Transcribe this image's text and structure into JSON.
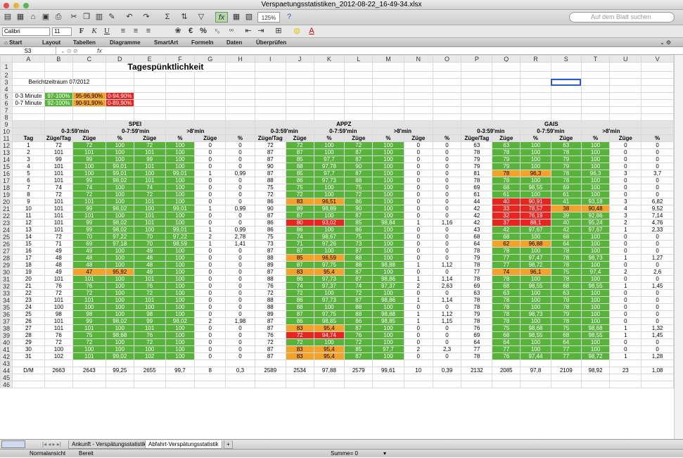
{
  "window": {
    "title": "Verspaetungsstatistiken_2012-08-22_16-49-34.xlsx"
  },
  "toolbar": {
    "zoom": "125%",
    "search_placeholder": "Auf dem Blatt suchen"
  },
  "format": {
    "font": "Calibri",
    "size": "11"
  },
  "ribbon": {
    "tabs": [
      "Start",
      "Layout",
      "Tabellen",
      "Diagramme",
      "SmartArt",
      "Formeln",
      "Daten",
      "Überprüfen"
    ]
  },
  "formula": {
    "cell": "S3",
    "fx": "fx"
  },
  "columns": [
    "A",
    "B",
    "C",
    "D",
    "E",
    "F",
    "G",
    "H",
    "I",
    "J",
    "K",
    "L",
    "M",
    "N",
    "O",
    "P",
    "Q",
    "R",
    "S",
    "T",
    "U",
    "V"
  ],
  "sheet": {
    "title": "Tagespünktlichkeit",
    "period": "Berichtzeitraum 07/2012",
    "legend": [
      {
        "label": "0-3 Minute",
        "g": "97-100%",
        "o": "95-96,90%",
        "r": "0-94,90%"
      },
      {
        "label": "0-7 Minute",
        "g": "92-100%",
        "o": "90-91,90%",
        "r": "0-89,90%"
      }
    ],
    "groups": [
      "SPEI",
      "APPZ",
      "GAIS"
    ],
    "subgroups": [
      "0-3:59'min",
      "0-7:59'min",
      ">8'min"
    ],
    "col_headers": {
      "tag": "Tag",
      "zuege_tag": "Züge/Tag",
      "zuege": "Züge",
      "pct": "%"
    },
    "rows": [
      {
        "r": 12,
        "v": [
          "1",
          "72",
          "72",
          "100",
          "72",
          "100",
          "0",
          "0",
          "72",
          "72",
          "100",
          "72",
          "100",
          "0",
          "0",
          "63",
          "63",
          "100",
          "63",
          "100",
          "0",
          "0"
        ],
        "c": "..gggg....gggg....gggg.."
      },
      {
        "r": 13,
        "v": [
          "2",
          "101",
          "101",
          "100",
          "101",
          "100",
          "0",
          "0",
          "87",
          "87",
          "100",
          "87",
          "100",
          "0",
          "0",
          "78",
          "78",
          "100",
          "78",
          "100",
          "0",
          "0"
        ]
      },
      {
        "r": 14,
        "v": [
          "3",
          "99",
          "99",
          "100",
          "99",
          "100",
          "0",
          "0",
          "87",
          "85",
          "97,7",
          "87",
          "100",
          "0",
          "0",
          "79",
          "79",
          "100",
          "79",
          "100",
          "0",
          "0"
        ]
      },
      {
        "r": 15,
        "v": [
          "4",
          "101",
          "100",
          "99,01",
          "101",
          "100",
          "0",
          "0",
          "90",
          "88",
          "97,78",
          "90",
          "100",
          "0",
          "0",
          "79",
          "79",
          "100",
          "79",
          "100",
          "0",
          "0"
        ]
      },
      {
        "r": 16,
        "v": [
          "5",
          "101",
          "100",
          "99,01",
          "100",
          "99,01",
          "1",
          "0,99",
          "87",
          "85",
          "97,7",
          "87",
          "100",
          "0",
          "0",
          "81",
          "78",
          "96,3",
          "78",
          "96,3",
          "3",
          "3,7"
        ],
        "s": {
          "16": "o",
          "17": "o"
        }
      },
      {
        "r": 17,
        "v": [
          "6",
          "101",
          "99",
          "98,02",
          "101",
          "100",
          "0",
          "0",
          "88",
          "86",
          "97,73",
          "88",
          "100",
          "0",
          "0",
          "78",
          "78",
          "100",
          "78",
          "100",
          "0",
          "0"
        ]
      },
      {
        "r": 18,
        "v": [
          "7",
          "74",
          "74",
          "100",
          "74",
          "100",
          "0",
          "0",
          "75",
          "75",
          "100",
          "75",
          "100",
          "0",
          "0",
          "69",
          "68",
          "98,55",
          "69",
          "100",
          "0",
          "0"
        ]
      },
      {
        "r": 19,
        "v": [
          "8",
          "72",
          "72",
          "100",
          "72",
          "100",
          "0",
          "0",
          "72",
          "72",
          "100",
          "72",
          "100",
          "0",
          "0",
          "61",
          "61",
          "100",
          "61",
          "100",
          "0",
          "0"
        ]
      },
      {
        "r": 20,
        "v": [
          "9",
          "101",
          "101",
          "100",
          "101",
          "100",
          "0",
          "0",
          "86",
          "83",
          "96,51",
          "86",
          "100",
          "0",
          "0",
          "44",
          "40",
          "90,91",
          "41",
          "93,18",
          "3",
          "6,82"
        ],
        "s": {
          "9": "o",
          "10": "o",
          "16": "r",
          "17": "r"
        }
      },
      {
        "r": 21,
        "v": [
          "10",
          "101",
          "99",
          "98,02",
          "100",
          "99,01",
          "1",
          "0,99",
          "90",
          "89",
          "98,89",
          "90",
          "100",
          "0",
          "0",
          "42",
          "33",
          "78,57",
          "38",
          "90,48",
          "4",
          "9,52"
        ],
        "s": {
          "16": "r",
          "17": "r",
          "18": "o",
          "19": "o"
        }
      },
      {
        "r": 22,
        "v": [
          "11",
          "101",
          "101",
          "100",
          "101",
          "100",
          "0",
          "0",
          "87",
          "87",
          "100",
          "87",
          "100",
          "0",
          "0",
          "42",
          "32",
          "76,19",
          "39",
          "92,86",
          "3",
          "7,14"
        ],
        "s": {
          "16": "r",
          "17": "r"
        }
      },
      {
        "r": 23,
        "v": [
          "12",
          "101",
          "99",
          "98,02",
          "101",
          "100",
          "0",
          "0",
          "86",
          "80",
          "93,02",
          "85",
          "98,84",
          "1",
          "1,16",
          "42",
          "37",
          "88,1",
          "40",
          "95,24",
          "2",
          "4,76"
        ],
        "s": {
          "9": "r",
          "10": "r",
          "16": "r",
          "17": "r"
        }
      },
      {
        "r": 24,
        "v": [
          "13",
          "101",
          "99",
          "98,02",
          "100",
          "99,01",
          "1",
          "0,99",
          "86",
          "86",
          "100",
          "86",
          "100",
          "0",
          "0",
          "43",
          "42",
          "97,67",
          "42",
          "97,67",
          "1",
          "2,33"
        ]
      },
      {
        "r": 25,
        "v": [
          "14",
          "72",
          "70",
          "97,22",
          "70",
          "97,22",
          "2",
          "2,78",
          "75",
          "74",
          "98,67",
          "75",
          "100",
          "0",
          "0",
          "68",
          "68",
          "100",
          "68",
          "100",
          "0",
          "0"
        ]
      },
      {
        "r": 26,
        "v": [
          "15",
          "71",
          "69",
          "97,18",
          "70",
          "98,59",
          "1",
          "1,41",
          "73",
          "71",
          "97,26",
          "73",
          "100",
          "0",
          "0",
          "64",
          "62",
          "96,88",
          "64",
          "100",
          "0",
          "0"
        ],
        "s": {
          "16": "o",
          "17": "o"
        }
      },
      {
        "r": 27,
        "v": [
          "16",
          "49",
          "49",
          "100",
          "49",
          "100",
          "0",
          "0",
          "87",
          "87",
          "100",
          "87",
          "100",
          "0",
          "0",
          "78",
          "78",
          "100",
          "78",
          "100",
          "0",
          "0"
        ]
      },
      {
        "r": 28,
        "v": [
          "17",
          "48",
          "48",
          "100",
          "48",
          "100",
          "0",
          "0",
          "88",
          "85",
          "96,59",
          "88",
          "100",
          "0",
          "0",
          "79",
          "77",
          "97,47",
          "78",
          "98,73",
          "1",
          "1,27"
        ],
        "s": {
          "9": "o",
          "10": "o"
        }
      },
      {
        "r": 29,
        "v": [
          "18",
          "48",
          "48",
          "100",
          "48",
          "100",
          "0",
          "0",
          "89",
          "87",
          "97,75",
          "88",
          "98,88",
          "1",
          "1,12",
          "78",
          "77",
          "98,72",
          "78",
          "100",
          "0",
          "0"
        ]
      },
      {
        "r": 30,
        "v": [
          "19",
          "49",
          "47",
          "95,92",
          "49",
          "100",
          "0",
          "0",
          "87",
          "83",
          "95,4",
          "87",
          "100",
          "0",
          "0",
          "77",
          "74",
          "96,1",
          "75",
          "97,4",
          "2",
          "2,6"
        ],
        "s": {
          "2": "o",
          "3": "o",
          "9": "o",
          "10": "o",
          "16": "o",
          "17": "o"
        }
      },
      {
        "r": 31,
        "v": [
          "20",
          "101",
          "101",
          "100",
          "101",
          "100",
          "0",
          "0",
          "88",
          "86",
          "97,73",
          "87",
          "98,86",
          "1",
          "1,14",
          "78",
          "78",
          "100",
          "78",
          "100",
          "0",
          "0"
        ]
      },
      {
        "r": 32,
        "v": [
          "21",
          "76",
          "76",
          "100",
          "76",
          "100",
          "0",
          "0",
          "76",
          "74",
          "97,37",
          "74",
          "97,37",
          "2",
          "2,63",
          "69",
          "68",
          "98,55",
          "68",
          "98,55",
          "1",
          "1,45"
        ]
      },
      {
        "r": 33,
        "v": [
          "22",
          "72",
          "72",
          "100",
          "72",
          "100",
          "0",
          "0",
          "72",
          "72",
          "100",
          "72",
          "100",
          "0",
          "0",
          "63",
          "63",
          "100",
          "63",
          "100",
          "0",
          "0"
        ]
      },
      {
        "r": 34,
        "v": [
          "23",
          "101",
          "101",
          "100",
          "101",
          "100",
          "0",
          "0",
          "88",
          "86",
          "97,73",
          "87",
          "98,86",
          "1",
          "1,14",
          "78",
          "78",
          "100",
          "78",
          "100",
          "0",
          "0"
        ]
      },
      {
        "r": 35,
        "v": [
          "24",
          "100",
          "100",
          "100",
          "100",
          "100",
          "0",
          "0",
          "88",
          "88",
          "100",
          "88",
          "100",
          "0",
          "0",
          "78",
          "78",
          "100",
          "78",
          "100",
          "0",
          "0"
        ]
      },
      {
        "r": 36,
        "v": [
          "25",
          "98",
          "98",
          "100",
          "98",
          "100",
          "0",
          "0",
          "89",
          "87",
          "97,75",
          "88",
          "98,88",
          "1",
          "1,12",
          "79",
          "78",
          "98,73",
          "79",
          "100",
          "0",
          "0"
        ]
      },
      {
        "r": 37,
        "v": [
          "26",
          "101",
          "99",
          "98,02",
          "99",
          "98,02",
          "2",
          "1,98",
          "87",
          "86",
          "98,85",
          "86",
          "98,85",
          "1",
          "1,15",
          "78",
          "78",
          "100",
          "78",
          "100",
          "0",
          "0"
        ]
      },
      {
        "r": 38,
        "v": [
          "27",
          "101",
          "101",
          "100",
          "101",
          "100",
          "0",
          "0",
          "87",
          "83",
          "95,4",
          "87",
          "100",
          "0",
          "0",
          "76",
          "75",
          "98,68",
          "75",
          "98,68",
          "1",
          "1,32"
        ],
        "s": {
          "9": "o",
          "10": "o"
        }
      },
      {
        "r": 39,
        "v": [
          "28",
          "76",
          "75",
          "98,68",
          "76",
          "100",
          "0",
          "0",
          "76",
          "72",
          "94,74",
          "76",
          "100",
          "0",
          "0",
          "69",
          "68",
          "98,55",
          "68",
          "98,55",
          "1",
          "1,45"
        ],
        "s": {
          "9": "r",
          "10": "r"
        }
      },
      {
        "r": 40,
        "v": [
          "29",
          "72",
          "72",
          "100",
          "72",
          "100",
          "0",
          "0",
          "72",
          "72",
          "100",
          "72",
          "100",
          "0",
          "0",
          "64",
          "64",
          "100",
          "64",
          "100",
          "0",
          "0"
        ]
      },
      {
        "r": 41,
        "v": [
          "30",
          "100",
          "100",
          "100",
          "100",
          "100",
          "0",
          "0",
          "87",
          "83",
          "95,4",
          "85",
          "97,7",
          "2",
          "2,3",
          "77",
          "77",
          "100",
          "77",
          "100",
          "0",
          "0"
        ],
        "s": {
          "9": "o",
          "10": "o"
        }
      },
      {
        "r": 42,
        "v": [
          "31",
          "102",
          "101",
          "99,02",
          "102",
          "100",
          "0",
          "0",
          "87",
          "83",
          "95,4",
          "87",
          "100",
          "0",
          "0",
          "78",
          "76",
          "97,44",
          "77",
          "98,72",
          "1",
          "1,28"
        ],
        "s": {
          "9": "o",
          "10": "o"
        }
      }
    ],
    "total": {
      "r": 44,
      "v": [
        "D/M",
        "2663",
        "2643",
        "99,25",
        "2655",
        "99,7",
        "8",
        "0,3",
        "2589",
        "2534",
        "97,88",
        "2579",
        "99,61",
        "10",
        "0,39",
        "2132",
        "2085",
        "97,8",
        "2109",
        "98,92",
        "23",
        "1,08"
      ]
    }
  },
  "sheettabs": [
    "Ankunft - Verspätungsstatistik",
    "Abfahrt-Verspätungsstatistik"
  ],
  "status": {
    "view": "Normalansicht",
    "ready": "Bereit",
    "sum": "Summe= 0"
  }
}
